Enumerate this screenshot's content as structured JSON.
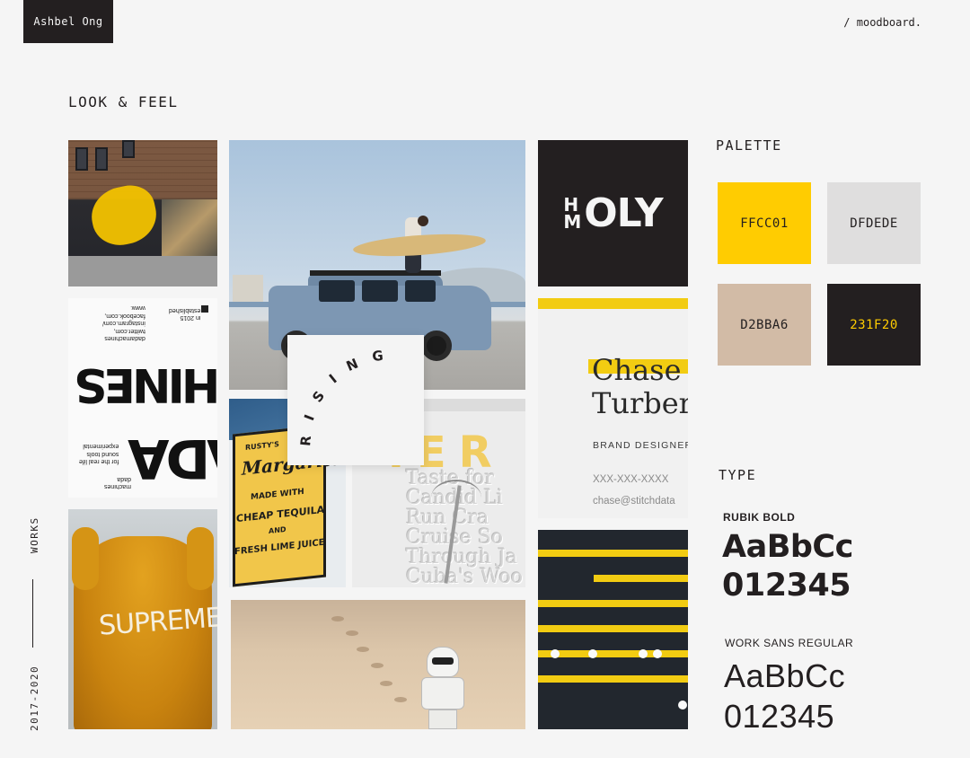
{
  "header": {
    "brand": "Ashbel Ong",
    "breadcrumb": "/ moodboard."
  },
  "rail": {
    "works": "WORKS",
    "years": "2017-2020"
  },
  "section_title": "LOOK & FEEL",
  "tiles": {
    "dada": {
      "word1": "DADA",
      "word2": "MACHINES",
      "established": "established",
      "year": "in 2015",
      "links": [
        "www.",
        "facebook.com,",
        "instagram.com/",
        "twitter.com,",
        "dadamachines"
      ],
      "tag": [
        "experimental",
        "sound tools",
        "for the real life"
      ],
      "tag2": [
        "dada",
        "machines"
      ]
    },
    "hoodie_word": "SUPREME",
    "rising_word": "RISING",
    "margarita": {
      "line1": "RUSTY'S",
      "line2": "Margarita",
      "line3": "MADE WITH",
      "line4": "CHEAP TEQUILA",
      "line5": "AND",
      "line6": "FRESH LIME JUICE"
    },
    "embossed": {
      "accent": "IER",
      "lines": [
        "Taste for",
        "Candid Li",
        "Run Cra",
        "Cruise So",
        "Through Ja",
        "Cuba's Woo"
      ]
    },
    "holy": {
      "h": "H",
      "m": "M",
      "text": "OLY"
    },
    "card": {
      "name_line1": "Chase",
      "name_line2": "Turber",
      "role": "BRAND DESIGNER",
      "phone": "XXX-XXX-XXXX",
      "email": "chase@stitchdata"
    }
  },
  "palette": {
    "title": "PALETTE",
    "colors": [
      {
        "hex": "FFCC01",
        "bg": "#FFCC01",
        "fg": "#231F20"
      },
      {
        "hex": "DFDEDE",
        "bg": "#DFDEDE",
        "fg": "#231F20"
      },
      {
        "hex": "D2BBA6",
        "bg": "#D2BBA6",
        "fg": "#231F20"
      },
      {
        "hex": "231F20",
        "bg": "#231F20",
        "fg": "#FFCC01"
      }
    ]
  },
  "type": {
    "title": "TYPE",
    "fonts": [
      {
        "name": "RUBIK BOLD",
        "sample1": "AaBbCc",
        "sample2": "012345"
      },
      {
        "name": "WORK SANS REGULAR",
        "sample1": "AaBbCc",
        "sample2": "012345"
      }
    ]
  }
}
